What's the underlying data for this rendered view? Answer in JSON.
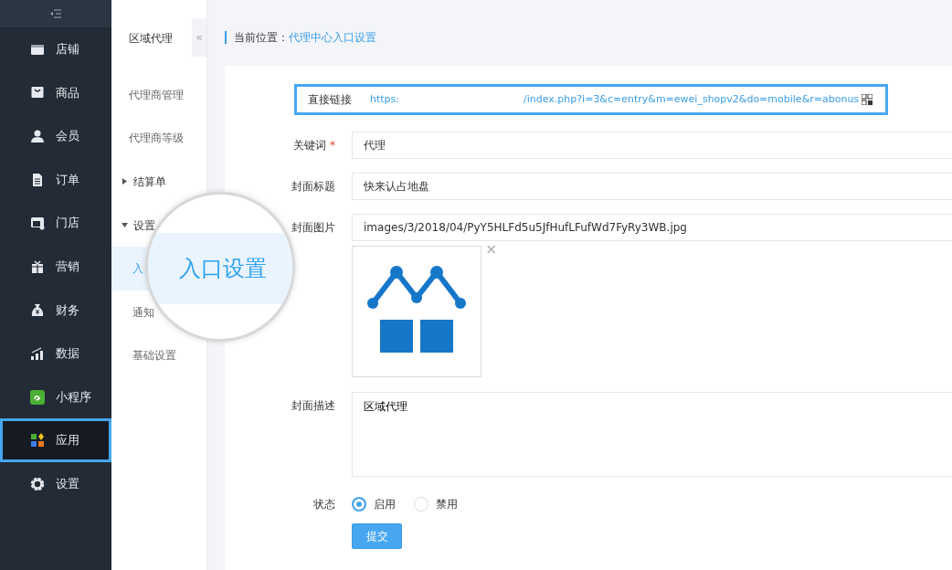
{
  "sidebar": {
    "items": [
      {
        "kind": "shop",
        "label": "店铺",
        "selected": false,
        "highlighted": false
      },
      {
        "kind": "bag",
        "label": "商品",
        "selected": false,
        "highlighted": false
      },
      {
        "kind": "user",
        "label": "会员",
        "selected": false,
        "highlighted": false
      },
      {
        "kind": "doc",
        "label": "订单",
        "selected": false,
        "highlighted": false
      },
      {
        "kind": "store",
        "label": "门店",
        "selected": false,
        "highlighted": false
      },
      {
        "kind": "gift",
        "label": "营销",
        "selected": false,
        "highlighted": false
      },
      {
        "kind": "money",
        "label": "财务",
        "selected": false,
        "highlighted": false
      },
      {
        "kind": "chart",
        "label": "数据",
        "selected": false,
        "highlighted": false
      },
      {
        "kind": "mini",
        "label": "小程序",
        "selected": false,
        "highlighted": false
      },
      {
        "kind": "apps",
        "label": "应用",
        "selected": true,
        "highlighted": true
      },
      {
        "kind": "gear",
        "label": "设置",
        "selected": false,
        "highlighted": false
      }
    ]
  },
  "submenu": {
    "title": "区域代理",
    "collapse_glyph": "«",
    "items": [
      {
        "kind": "link",
        "label": "代理商管理",
        "selected": false
      },
      {
        "kind": "link",
        "label": "代理商等级",
        "selected": false
      },
      {
        "kind": "group",
        "label": "结算单",
        "expanded": false
      },
      {
        "kind": "group",
        "label": "设置",
        "expanded": true,
        "children": [
          {
            "kind": "link",
            "label": "入",
            "selected": true
          },
          {
            "kind": "link",
            "label": "通知",
            "selected": false
          },
          {
            "kind": "link",
            "label": "基础设置",
            "selected": false
          }
        ]
      }
    ]
  },
  "magnifier": {
    "text": "入口设置"
  },
  "breadcrumb": {
    "label": "当前位置：",
    "current": "代理中心入口设置"
  },
  "form": {
    "fields": [
      {
        "kind": "link",
        "label": "直接链接",
        "value": "https:",
        "value_end": "/index.php?i=3&c=entry&m=ewei_shopv2&do=mobile&r=abonus",
        "highlighted": true
      },
      {
        "kind": "text",
        "label": "关键词",
        "required_mark": "*",
        "value": "代理"
      },
      {
        "kind": "text",
        "label": "封面标题",
        "value": "快来认占地盘"
      },
      {
        "label": "封面图片",
        "value": "images/3/2018/04/PyY5HLFd5u5JfHufLFufWd7FyRy3WB.jpg",
        "remove_glyph": "×"
      },
      {
        "kind": "textarea",
        "label": "封面描述",
        "value": "区域代理"
      },
      {
        "kind": "radio",
        "label": "状态",
        "options": [
          {
            "label": "启用",
            "selected": true
          },
          {
            "label": "禁用",
            "selected": false
          }
        ]
      }
    ],
    "submit": "提交"
  }
}
